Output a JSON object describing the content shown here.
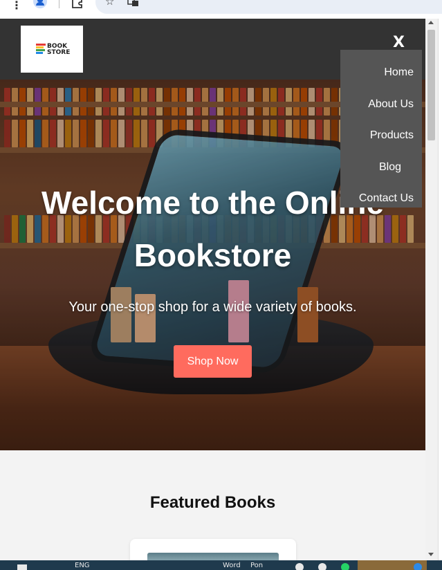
{
  "browser": {
    "menu_icon": "kebab-menu-icon",
    "profile_icon": "profile-icon",
    "extension_icon": "extensions-icon",
    "bookmark_icon": "star-icon",
    "translate_icon": "translate-icon"
  },
  "header": {
    "logo": {
      "line1": "BOOK",
      "line2": "STORE"
    },
    "close_label": "X",
    "background": "#333333"
  },
  "nav": {
    "items": [
      {
        "label": "Home"
      },
      {
        "label": "About Us"
      },
      {
        "label": "Products"
      },
      {
        "label": "Blog"
      },
      {
        "label": "Contact Us"
      }
    ],
    "background": "#555555"
  },
  "hero": {
    "title_line1": "Welcome to the Online",
    "title_line2": "Bookstore",
    "subtitle": "Your one-stop shop for a wide variety of books.",
    "cta_label": "Shop Now",
    "cta_color": "#ff6b5e"
  },
  "featured": {
    "title": "Featured Books"
  },
  "taskbar": {
    "lang": "ENG",
    "apps": [
      "Word",
      "Pon"
    ]
  }
}
